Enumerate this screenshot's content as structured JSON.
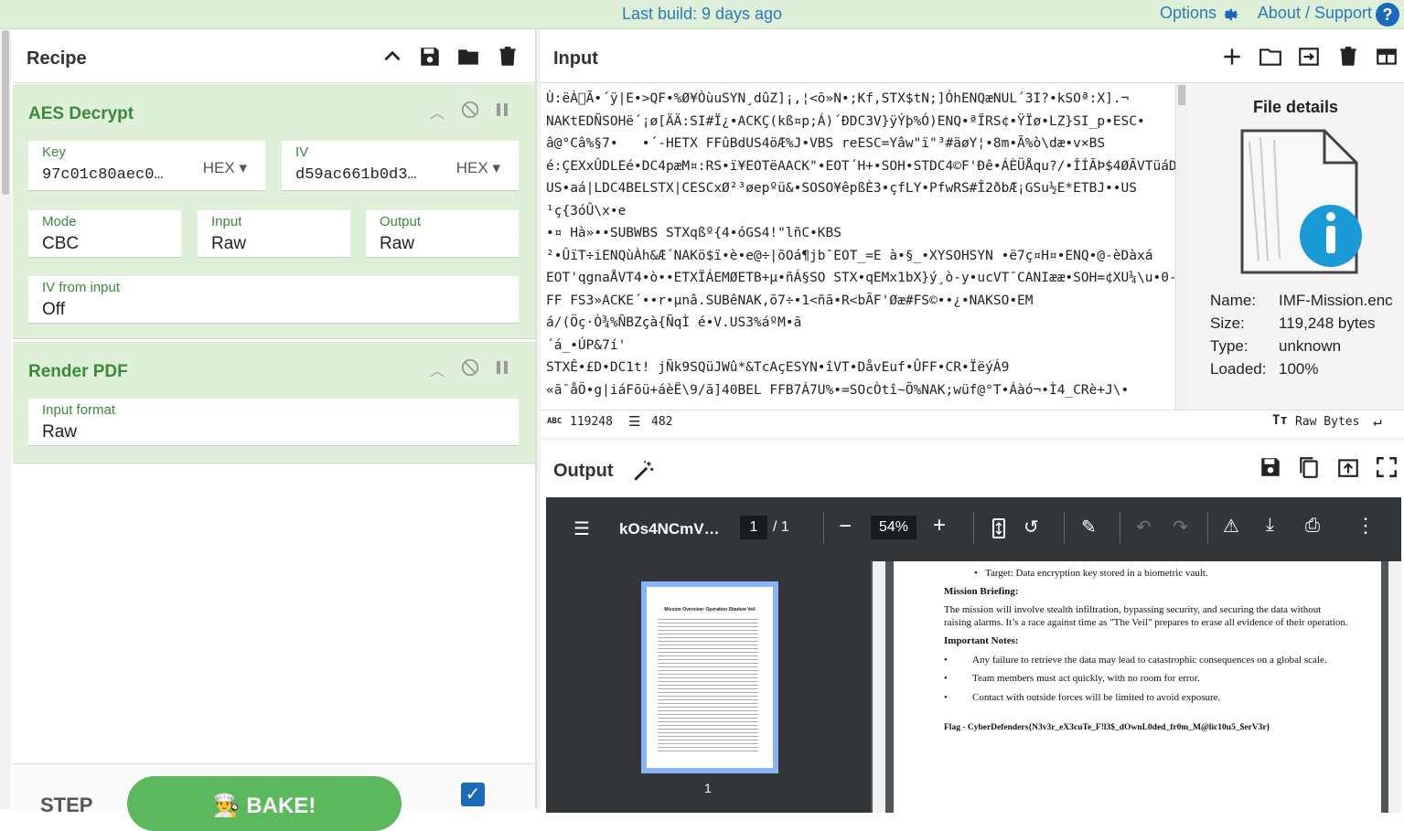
{
  "topbar": {
    "build": "Last build: 9 days ago",
    "options": "Options",
    "about": "About / Support",
    "help": "?"
  },
  "recipe": {
    "title": "Recipe",
    "ops": [
      {
        "name": "AES Decrypt",
        "key_label": "Key",
        "key_value": "97c01c80aec0…",
        "key_format": "HEX",
        "iv_label": "IV",
        "iv_value": "d59ac661b0d3…",
        "iv_format": "HEX",
        "mode_label": "Mode",
        "mode_value": "CBC",
        "input_label": "Input",
        "input_value": "Raw",
        "output_label": "Output",
        "output_value": "Raw",
        "ivfrom_label": "IV from input",
        "ivfrom_value": "Off"
      },
      {
        "name": "Render PDF",
        "format_label": "Input format",
        "format_value": "Raw"
      }
    ],
    "step": "STEP",
    "bake": "BAKE!",
    "autobake_checked": true
  },
  "input": {
    "title": "Input",
    "text": "Ù:ëÀ\u0000Ã•´ÿ|E•>QF•%Ø¥ÒùuSYN¸dûZ]¡,¦<õ»N•;Kf,STX$tN;]ÓhENQæNUL´3I?•kSOª:X].¬\nNAKtEDÑSOHë´¡ø[ÄÄ:SI#Ï¿•ACKÇ(kß¤p;Á)´ÐDC3V}ÿÝþ%Ó)ENQ•ªÏRS¢•ŸÏø•LZ}SI_p•ESC•\nâ@°Câ%§7•   •´-HETX FFûBdUS4öÆ%J•VBS reESC=Yâw\"ï\"³#äøY¦•8m•Ã%ò\\dæ•v×BS\né:ÇEXxÛDLEé•DC4pæM¤:RS•ï¥EOTëAACK\"•EOT´H+•SOH•STDC4©F'Ðê•ÁÈÜÅqu?/•ÎÍÃÞ$4ØÃVTüáDC1\nUS•aá|LDC4BELSTX|CESCxØ²³øepºü&•SOSO¥êpßÈ3•çfLY•PfwRS#Î2ðbÆ¡GSu½E*ETBJ••US\n¹ç{3óÛ\\x•e\n•¤ Hà»••SUBWBS STXqßº{4•óGS4!\"lñC•KBS\n²•ÛïT÷iENQùÀh&Æ´NAKö$ï•è•e@÷|õOá¶jb¯EOT_=E à•§_•XYSOHSYN •ë7ç¤H¤•ENQ•@-èDàxá\nEOT'qgnaÅVT4•ò••ETXÏÁEMØETB+µ•ñÁ§SO STX•qEMx1bX}ý¸ò-y•ucVT¯CANIææ•SOH=¢XU¼\\u•0-\nFF FS3»ACKE´••r•µnâ.SUBêNAK,õ7÷•1<ñã•R<bÃF'Øæ#FS©••¿•NAKSO•EM\ná/(Öç·Ò¾%ÑBZçà{ÑqÌ é•V.US3%áºM•ã\n´á_•ÚP&7í'\nSTXÊ•£D•DC1t! jÑk9SQüJWû*&TcAçESYN•îVT•DåvEuf•ÛFF•CR•ÏëýÁ9\n«ã¯åÖ•g|iáFõü+áèË\\9/ã]40BEL FFB7Á7U%•=SOcÒtî~Õ%NAK;wüf@°T•Áàó¬•Ì4_CRè+J\\•",
    "char_count": "119248",
    "line_count": "482",
    "raw_bytes": "Raw Bytes",
    "file": {
      "title": "File details",
      "name_label": "Name:",
      "name": "IMF-Mission.enc",
      "size_label": "Size:",
      "size": "119,248 bytes",
      "type_label": "Type:",
      "type": "unknown",
      "loaded_label": "Loaded:",
      "loaded": "100%"
    }
  },
  "output": {
    "title": "Output",
    "pdf": {
      "filename": "kOs4NCmV…",
      "page": "1",
      "pages": "/  1",
      "zoom": "54%",
      "thumb_label": "1",
      "lines": [
        "Target: Data encryption key stored in a biometric vault.",
        "Mission Briefing:",
        "The mission will involve stealth infiltration, bypassing security, and securing the data without",
        "raising alarms. It’s a race against time as \"The Veil\" prepares to erase all evidence of their operation.",
        "Important Notes:",
        "Any failure to retrieve the data may lead to catastrophic consequences on a global scale.",
        "Team members must act quickly, with no room for error.",
        "Contact with outside forces will be limited to avoid exposure.",
        "Flag - CyberDefenders{N3v3r_eX3cuTe_F!l3$_dOwnL0ded_fr0m_M@lic10u5_$erV3r}"
      ],
      "thumb_title": "Mission Overview: Operation Shadow Veil"
    }
  }
}
